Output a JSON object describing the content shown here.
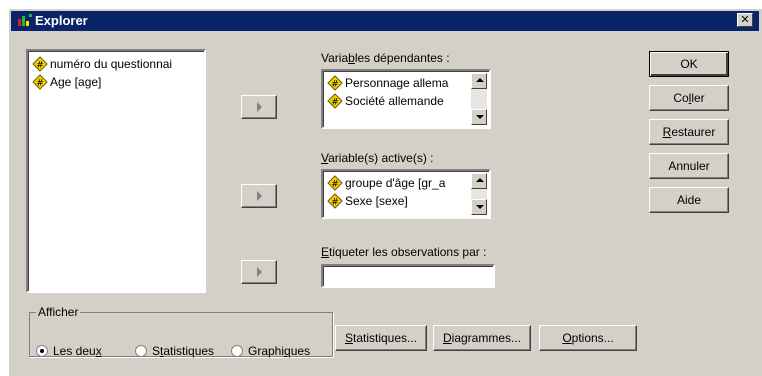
{
  "window": {
    "title": "Explorer",
    "close_glyph": "✕"
  },
  "source_list": {
    "items": [
      {
        "label": "numéro du questionnai",
        "icon": "scale-variable-icon"
      },
      {
        "label": "Age [age]",
        "icon": "scale-variable-icon"
      }
    ]
  },
  "dependent": {
    "label_pre": "Varia",
    "label_key": "b",
    "label_post": "les dépendantes :",
    "items": [
      {
        "label": "Personnage allema",
        "icon": "scale-variable-icon"
      },
      {
        "label": "Société allemande",
        "icon": "scale-variable-icon"
      }
    ]
  },
  "factors": {
    "label_pre": "",
    "label_key": "V",
    "label_post": "ariable(s) active(s) :",
    "items": [
      {
        "label": "groupe d'âge [gr_a",
        "icon": "scale-variable-icon"
      },
      {
        "label": "Sexe [sexe]",
        "icon": "scale-variable-icon"
      }
    ]
  },
  "label_cases": {
    "label_pre": "",
    "label_key": "E",
    "label_post": "tiqueter les observations par :",
    "value": ""
  },
  "buttons": {
    "ok": "OK",
    "paste_pre": "Co",
    "paste_key": "l",
    "paste_post": "ler",
    "reset_pre": "",
    "reset_key": "R",
    "reset_post": "estaurer",
    "cancel": "Annuler",
    "help": "Aide"
  },
  "display": {
    "legend": "Afficher",
    "options": [
      {
        "pre": "Les deu",
        "key": "x",
        "post": "",
        "selected": true
      },
      {
        "pre": "S",
        "key": "t",
        "post": "atistiques",
        "selected": false
      },
      {
        "pre": "Graphi",
        "key": "q",
        "post": "ues",
        "selected": false
      }
    ]
  },
  "bottom_buttons": {
    "statistics_pre": "",
    "statistics_key": "S",
    "statistics_post": "tatistiques...",
    "plots_pre": "",
    "plots_key": "D",
    "plots_post": "iagrammes...",
    "options_pre": "",
    "options_key": "O",
    "options_post": "ptions..."
  },
  "colors": {
    "titlebar": "#0a246a",
    "face": "#d4d0c8",
    "icon_fill": "#f2d200"
  }
}
